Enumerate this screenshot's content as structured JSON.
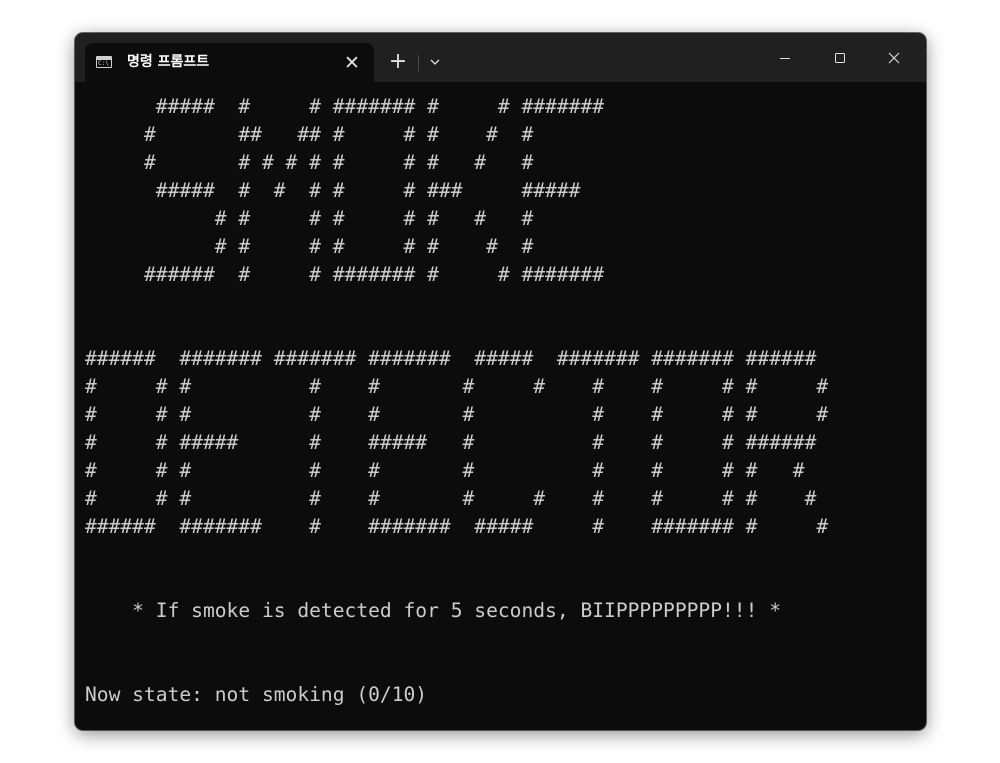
{
  "window": {
    "tab_title": "명령 프롬프트",
    "tab_icon": "C:\\"
  },
  "icons": {
    "tab_icon": "command-prompt-icon",
    "tab_close": "close-icon",
    "new_tab": "plus-icon",
    "dropdown": "chevron-down-icon",
    "minimize": "minimize-icon",
    "maximize": "maximize-icon",
    "close": "close-icon"
  },
  "colors": {
    "terminal_bg": "#0c0c0c",
    "terminal_fg": "#cccccc",
    "titlebar_bg": "#202020"
  },
  "terminal": {
    "smoke_art": [
      "      #####  #     # ####### #     # #######",
      "     #       ##   ## #     # #    #  #",
      "     #       # # # # #     # #   #   #",
      "      #####  #  #  # #     # ###     #####",
      "           # #     # #     # #   #   #",
      "           # #     # #     # #    #  #",
      "     ######  #     # ####### #     # #######"
    ],
    "detector_art": [
      "######  ####### ####### #######  #####  ####### ####### ######",
      "#     # #          #    #       #     #    #    #     # #     #",
      "#     # #          #    #       #          #    #     # #     #",
      "#     # #####      #    #####   #          #    #     # ######",
      "#     # #          #    #       #          #    #     # #   #",
      "#     # #          #    #       #     #    #    #     # #    #",
      "######  #######    #    #######  #####     #    ####### #     #"
    ],
    "message": "    * If smoke is detected for 5 seconds, BIIPPPPPPPPP!!! *",
    "status": "Now state: not smoking (0/10)"
  }
}
